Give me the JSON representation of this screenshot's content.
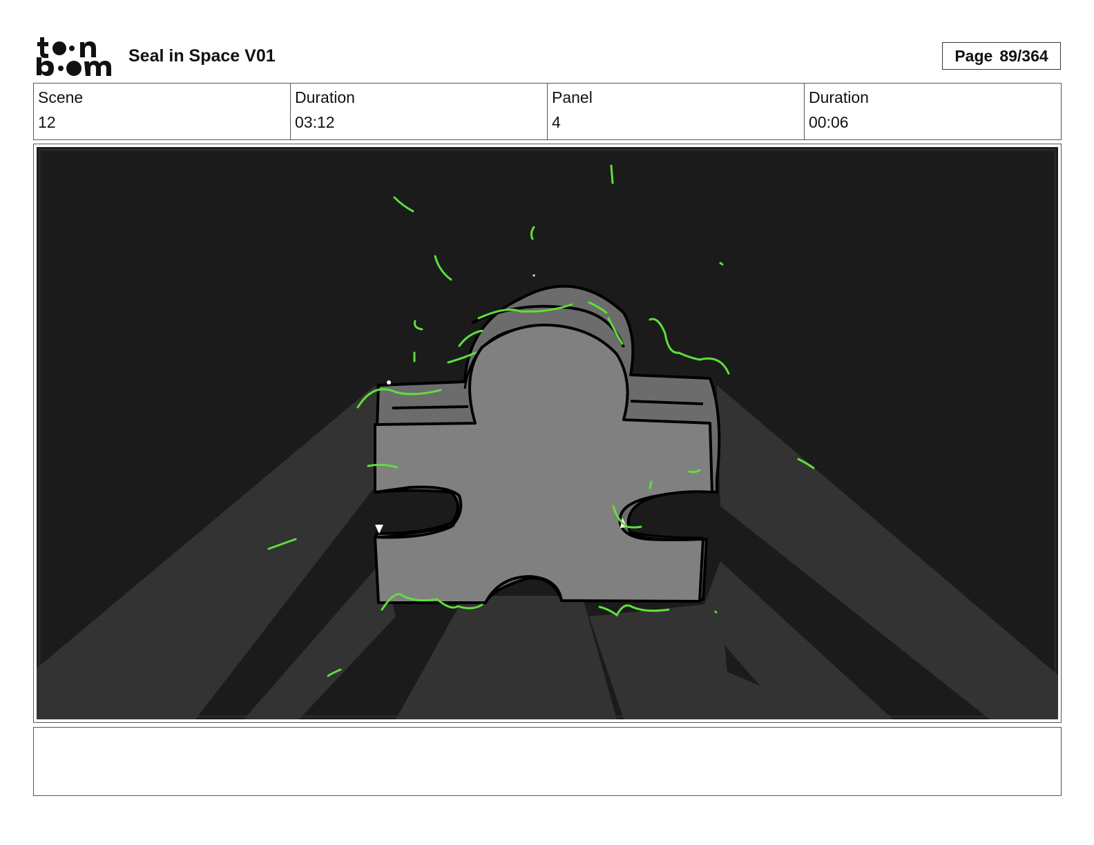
{
  "header": {
    "logo_text": "toon boom",
    "title": "Seal in Space V01",
    "page_label": "Page",
    "page_value": "89/364"
  },
  "info": {
    "scene_label": "Scene",
    "scene_value": "12",
    "scene_duration_label": "Duration",
    "scene_duration_value": "03:12",
    "panel_label": "Panel",
    "panel_value": "4",
    "panel_duration_label": "Duration",
    "panel_duration_value": "00:06"
  },
  "panel": {
    "background_color": "#1b1b1b",
    "beam_color": "#333333",
    "piece_color": "#808080",
    "piece_shadow_color": "#6c6c6c",
    "sparkle_color": "#5fe03a"
  },
  "notes": {
    "text": ""
  }
}
